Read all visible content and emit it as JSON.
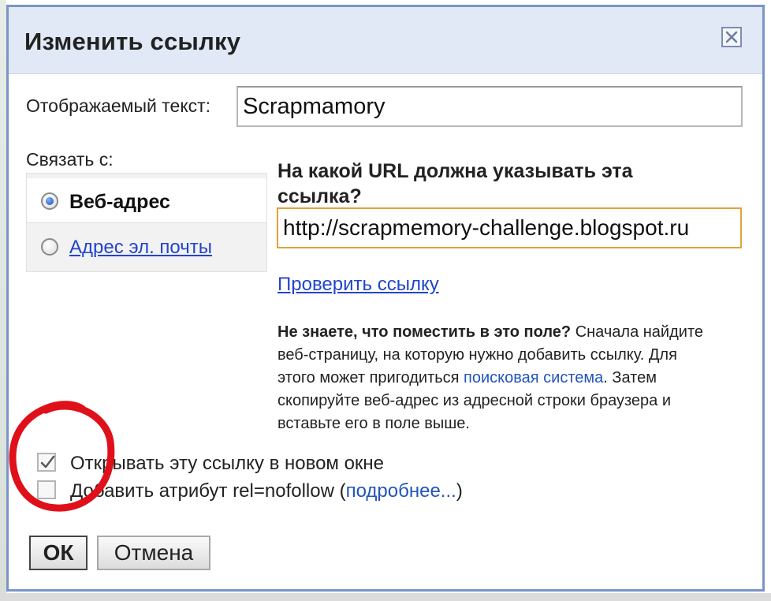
{
  "dialog": {
    "title": "Изменить ссылку"
  },
  "display_text": {
    "label": "Отображаемый текст:",
    "value": "Scrapmamory"
  },
  "link_to": {
    "label": "Связать с:",
    "options": [
      {
        "label": "Веб-адрес",
        "selected": true
      },
      {
        "label": "Адрес эл. почты",
        "selected": false
      }
    ]
  },
  "url": {
    "question": "На какой URL должна указывать эта ссылка?",
    "value": "http://scrapmemory-challenge.blogspot.ru",
    "check_link": "Проверить ссылку"
  },
  "help": {
    "bold_lead": "Не знаете, что поместить в это поле?",
    "text_1": " Сначала найдите веб-страницу, на которую нужно добавить ссылку. Для этого может пригодиться ",
    "link": "поисковая система",
    "text_2": ". Затем скопируйте веб-адрес из адресной строки браузера и вставьте его в поле выше."
  },
  "options": {
    "new_window": {
      "label": "Открывать эту ссылку в новом окне",
      "checked": true
    },
    "nofollow": {
      "label": "Добавить атрибут rel=nofollow",
      "open_paren": " (",
      "more_link": "подробнее...",
      "close_paren": ")",
      "checked": false
    }
  },
  "buttons": {
    "ok": "ОК",
    "cancel": "Отмена"
  },
  "colors": {
    "dialog_border": "#7a95c8",
    "titlebar": "#e1e9f7",
    "link_blue": "#2244cc",
    "url_input_focus": "#e3a23a",
    "annotation_red": "#e0101a"
  },
  "icons": {
    "close": "close-icon",
    "check": "checkmark-icon",
    "radio": "radio-icon"
  }
}
